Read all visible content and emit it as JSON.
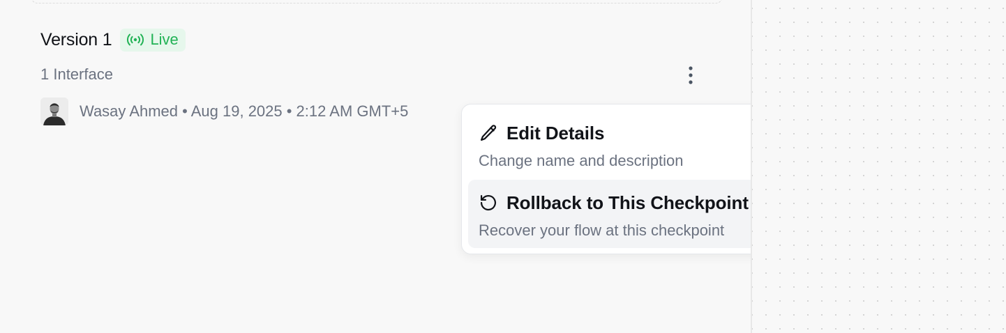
{
  "version": {
    "title": "Version 1",
    "status_badge": "Live",
    "interfaces": "1 Interface",
    "author_line": "Wasay Ahmed • Aug 19, 2025 • 2:12 AM GMT+5"
  },
  "icons": {
    "status": "broadcast-icon",
    "more": "kebab-menu-icon",
    "edit": "pencil-icon",
    "rollback": "rotate-ccw-icon"
  },
  "colors": {
    "live_green": "#21b255",
    "live_bg": "#e6f7ec",
    "highlight": "#f3f4f6"
  },
  "menu": {
    "items": [
      {
        "title": "Edit Details",
        "description": "Change name and description"
      },
      {
        "title": "Rollback to This Checkpoint",
        "description": "Recover your flow at this checkpoint"
      }
    ]
  }
}
